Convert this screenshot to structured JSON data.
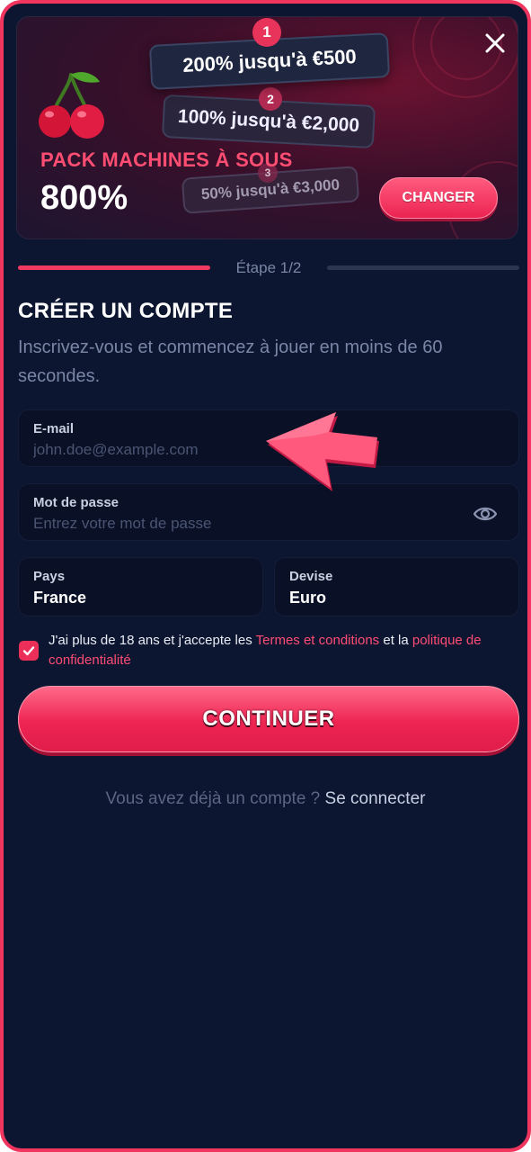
{
  "banner": {
    "offers": [
      {
        "number": "1",
        "text": "200% jusqu'à €500"
      },
      {
        "number": "2",
        "text": "100% jusqu'à €2,000"
      },
      {
        "number": "3",
        "text": "50% jusqu'à €3,000"
      }
    ],
    "pack_title": "PACK MACHINES À SOUS",
    "pack_percent": "800%",
    "change_label": "CHANGER",
    "close_icon": "close-icon",
    "cherry_icon": "cherry-icon"
  },
  "progress": {
    "step_label": "Étape 1/2",
    "fraction": 0.5
  },
  "form": {
    "title": "CRÉER UN COMPTE",
    "subtitle": "Inscrivez-vous et commencez à jouer en moins de 60 secondes.",
    "email": {
      "label": "E-mail",
      "placeholder": "john.doe@example.com",
      "value": ""
    },
    "password": {
      "label": "Mot de passe",
      "placeholder": "Entrez votre mot de passe",
      "value": "",
      "icon": "eye-icon"
    },
    "country": {
      "label": "Pays",
      "value": "France"
    },
    "currency": {
      "label": "Devise",
      "value": "Euro"
    },
    "terms": {
      "checked": true,
      "prefix": "J'ai plus de 18 ans et j'accepte les ",
      "terms_link": "Termes et conditions",
      "middle": " et la ",
      "privacy_link": "politique de confidentialité"
    },
    "continue_label": "CONTINUER",
    "login_prompt": "Vous avez déjà un compte ? ",
    "login_link": "Se connecter"
  },
  "colors": {
    "accent": "#f0355f",
    "background": "#0d1630",
    "field_bg": "#0a1126",
    "muted_text": "#7a86a6"
  }
}
